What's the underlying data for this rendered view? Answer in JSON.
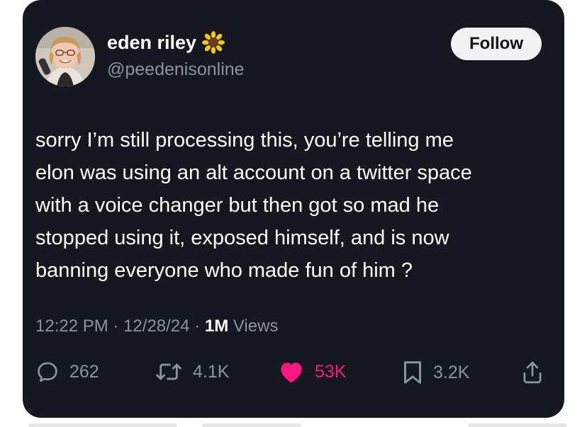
{
  "user": {
    "display_name": "eden riley",
    "name_emoji": "sunflower-icon",
    "handle": "@peedenisonline",
    "follow_label": "Follow"
  },
  "tweet": {
    "lines": [
      "sorry I’m still processing this, you’re telling me",
      "elon was using an alt account on a twitter space",
      "with a voice changer but then got so mad he",
      "stopped using it, exposed himself, and is now",
      "banning everyone who made fun of him ?"
    ]
  },
  "meta": {
    "time": "12:22 PM",
    "sep1": "·",
    "date": "12/28/24",
    "sep2": "·",
    "views_count": "1M",
    "views_label": "Views"
  },
  "actions": {
    "replies": "262",
    "reposts": "4.1K",
    "likes": "53K",
    "bookmarks": "3.2K"
  },
  "colors": {
    "card_bg": "#15181f",
    "text": "#ffffff",
    "muted": "#8b939b",
    "like": "#f91880",
    "follow_bg": "#eff3f4"
  }
}
